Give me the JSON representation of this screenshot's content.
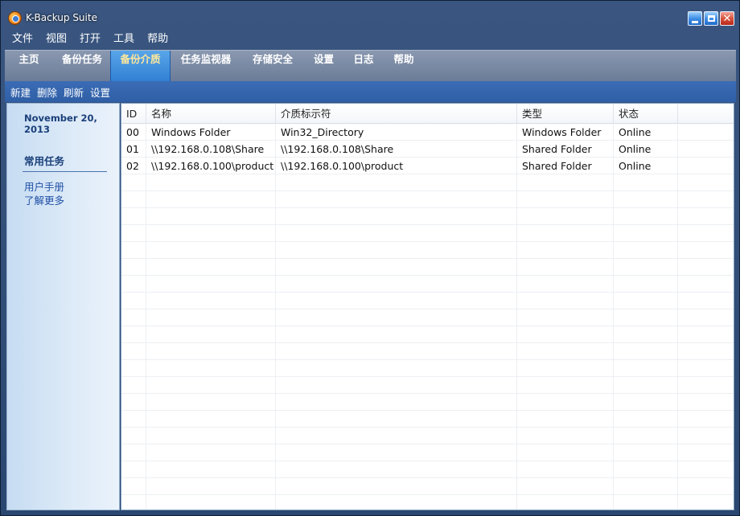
{
  "app": {
    "title": "K-Backup Suite",
    "icon": "app-logo-icon"
  },
  "window_controls": [
    "minimize-icon",
    "maximize-icon",
    "close-icon"
  ],
  "menu": [
    "文件",
    "视图",
    "打开",
    "工具",
    "帮助"
  ],
  "tabs": [
    {
      "label": "主页",
      "active": false
    },
    {
      "label": "备份任务",
      "active": false
    },
    {
      "label": "备份介质",
      "active": true
    },
    {
      "label": "任务监视器",
      "active": false
    },
    {
      "label": "存储安全",
      "active": false
    },
    {
      "label": "设置",
      "active": false
    },
    {
      "label": "日志",
      "active": false
    },
    {
      "label": "帮助",
      "active": false
    }
  ],
  "toolbar": {
    "new": "新建",
    "delete": "删除",
    "refresh": "刷新",
    "settings": "设置"
  },
  "sidebar": {
    "date": "November 20, 2013",
    "heading": "常用任务",
    "links": [
      "用户手册",
      "了解更多"
    ]
  },
  "table": {
    "columns": [
      "ID",
      "名称",
      "介质标示符",
      "类型",
      "状态",
      ""
    ],
    "rows": [
      [
        "00",
        "Windows Folder",
        "Win32_Directory",
        "Windows Folder",
        "Online"
      ],
      [
        "01",
        "\\\\192.168.0.108\\Share",
        "\\\\192.168.0.108\\Share",
        "Shared Folder",
        "Online"
      ],
      [
        "02",
        "\\\\192.168.0.100\\product",
        "\\\\192.168.0.100\\product",
        "Shared Folder",
        "Online"
      ]
    ]
  },
  "colors": {
    "accent": "#2f7fd2",
    "active_tab_text": "#ffe89a",
    "sidebar_text": "#1a3f7a",
    "link": "#2050a6"
  }
}
